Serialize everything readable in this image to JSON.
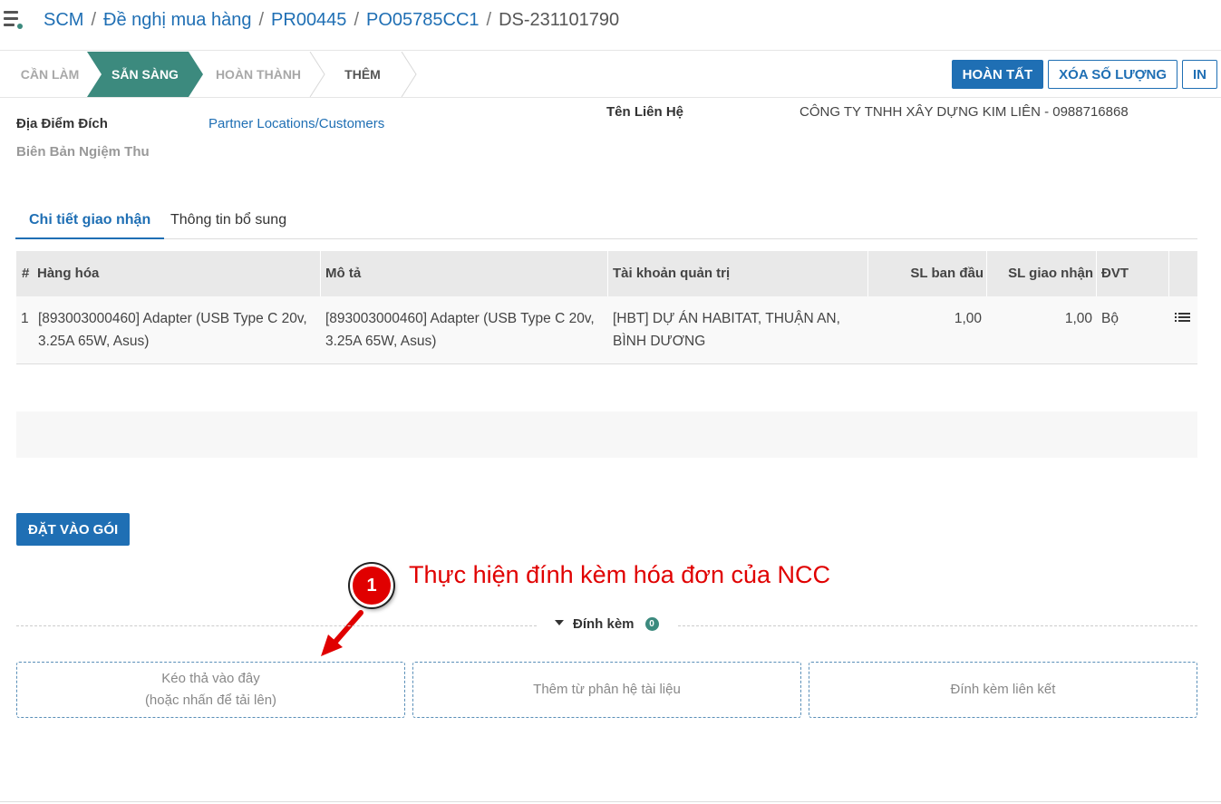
{
  "breadcrumb": {
    "items": [
      "SCM",
      "Đề nghị mua hàng",
      "PR00445",
      "PO05785CC1"
    ],
    "current": "DS-231101790",
    "separator": "/"
  },
  "stages": {
    "todo": "CẦN LÀM",
    "ready": "SẴN SÀNG",
    "done": "HOÀN THÀNH",
    "more": "THÊM",
    "active_color": "#3c8a7e"
  },
  "actions": {
    "complete": "HOÀN TẤT",
    "clear_qty": "XÓA SỐ LƯỢNG",
    "print": "IN"
  },
  "form": {
    "destination_label": "Địa Điểm Đích",
    "destination_value": "Partner Locations/Customers",
    "acceptance_label": "Biên Bản Ngiệm Thu",
    "contact_label": "Tên Liên Hệ",
    "contact_value": "CÔNG TY TNHH XÂY DỰNG KIM LIÊN - 0988716868"
  },
  "tabs": {
    "detail": "Chi tiết giao nhận",
    "extra": "Thông tin bổ sung"
  },
  "table": {
    "headers": {
      "index": "#",
      "product": "Hàng hóa",
      "description": "Mô tả",
      "account": "Tài khoản quản trị",
      "initial_qty": "SL ban đầu",
      "delivered_qty": "SL giao nhận",
      "uom": "ĐVT"
    },
    "rows": [
      {
        "index": "1",
        "product": "[893003000460] Adapter (USB Type C 20v, 3.25A 65W, Asus)",
        "description": "[893003000460] Adapter (USB Type C 20v, 3.25A 65W, Asus)",
        "account": "[HBT] DỰ ÁN HABITAT, THUẬN AN, BÌNH DƯƠNG",
        "initial_qty": "1,00",
        "delivered_qty": "1,00",
        "uom": "Bộ"
      }
    ]
  },
  "pack_button": "ĐẶT VÀO GÓI",
  "annotation": {
    "number": "1",
    "text": "Thực hiện đính kèm hóa đơn của NCC",
    "color": "#e00000"
  },
  "attachments": {
    "title": "Đính kèm",
    "count": "0",
    "drop_line1": "Kéo thả vào đây",
    "drop_line2": "(hoặc nhấn để tải lên)",
    "from_docs": "Thêm từ phân hệ tài liệu",
    "link": "Đính kèm liên kết"
  }
}
